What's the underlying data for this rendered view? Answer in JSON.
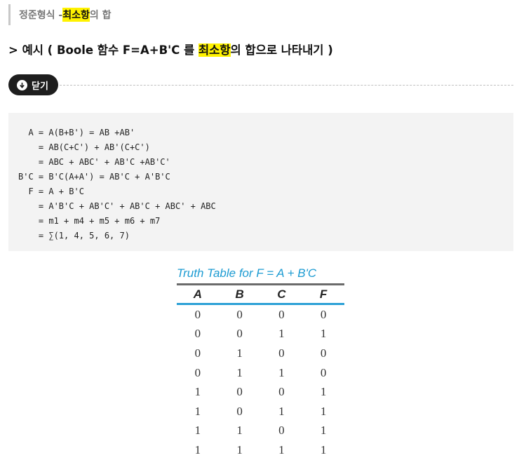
{
  "breadcrumb": {
    "prefix": "정준형식 - ",
    "highlight": "최소항",
    "suffix": "의 합"
  },
  "heading": {
    "prefix": "> 예시 ( Boole 함수 F=A+B'C 를 ",
    "highlight": "최소항",
    "suffix": "의 합으로 나타내기 )"
  },
  "toggle": {
    "label": "닫기"
  },
  "code_lines": [
    "  A = A(B+B') = AB +AB'",
    "    = AB(C+C') + AB'(C+C')",
    "    = ABC + ABC' + AB'C +AB'C'",
    "B'C = B'C(A+A') = AB'C + A'B'C",
    "  F = A + B'C",
    "    = A'B'C + AB'C' + AB'C + ABC' + ABC",
    "    = m1 + m4 + m5 + m6 + m7",
    "    = ∑(1, 4, 5, 6, 7)"
  ],
  "truth_table": {
    "title": "Truth Table for F = A + B'C",
    "columns": [
      "A",
      "B",
      "C",
      "F"
    ],
    "rows": [
      [
        "0",
        "0",
        "0",
        "0"
      ],
      [
        "0",
        "0",
        "1",
        "1"
      ],
      [
        "0",
        "1",
        "0",
        "0"
      ],
      [
        "0",
        "1",
        "1",
        "0"
      ],
      [
        "1",
        "0",
        "0",
        "1"
      ],
      [
        "1",
        "0",
        "1",
        "1"
      ],
      [
        "1",
        "1",
        "0",
        "1"
      ],
      [
        "1",
        "1",
        "1",
        "1"
      ]
    ]
  }
}
